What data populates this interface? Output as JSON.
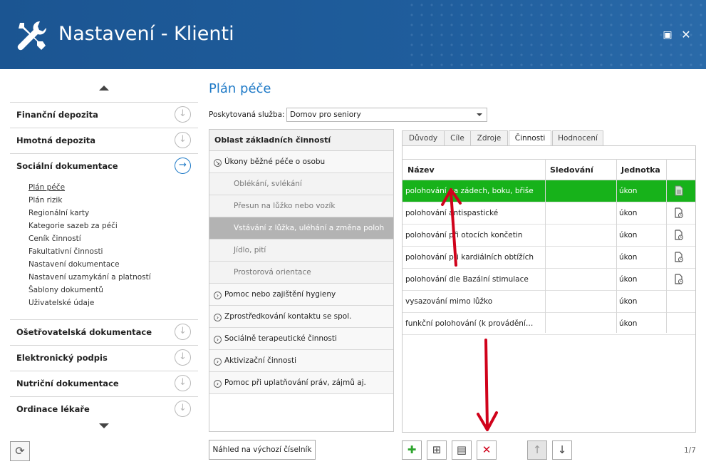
{
  "window": {
    "title": "Nastavení - Klienti",
    "maximize_glyph": "▣",
    "close_glyph": "✕"
  },
  "colors": {
    "titlebar": "#1e5b99",
    "accent": "#1f7ac7",
    "selected_row": "#17b21a",
    "selected_area": "#b3b3b3",
    "annotation_arrow": "#d0021b"
  },
  "sidebar": {
    "sections": [
      {
        "label": "Finanční depozita",
        "icon": "chevron-down-circle-icon"
      },
      {
        "label": "Hmotná depozita",
        "icon": "chevron-down-circle-icon"
      },
      {
        "label": "Sociální dokumentace",
        "icon": "arrow-right-circle-icon",
        "active": true
      },
      {
        "label": "Ošetřovatelská dokumentace",
        "icon": "chevron-down-circle-icon"
      },
      {
        "label": "Elektronický podpis",
        "icon": "chevron-down-circle-icon"
      },
      {
        "label": "Nutriční dokumentace",
        "icon": "chevron-down-circle-icon"
      },
      {
        "label": "Ordinace lékaře",
        "icon": "chevron-down-circle-icon"
      }
    ],
    "sub_items": [
      "Plán péče",
      "Plán rizik",
      "Regionální karty",
      "Kategorie sazeb za péči",
      "Ceník činností",
      "Fakultativní činnosti",
      "Nastavení dokumentace",
      "Nastavení uzamykání a platností",
      "Šablony dokumentů",
      "Uživatelské údaje"
    ]
  },
  "main": {
    "title": "Plán péče",
    "service_label": "Poskytovaná služba:",
    "service_value": "Domov pro seniory",
    "area_header": "Oblast základních činností",
    "areas": [
      {
        "label": "Úkony běžné péče o osobu",
        "kind": "group-open"
      },
      {
        "label": "Oblékání, svlékání",
        "kind": "child"
      },
      {
        "label": "Přesun na lůžko nebo vozík",
        "kind": "child"
      },
      {
        "label": "Vstávání z lůžka, uléhání a změna poloh",
        "kind": "child-selected"
      },
      {
        "label": "Jídlo, pití",
        "kind": "child"
      },
      {
        "label": "Prostorová orientace",
        "kind": "child"
      },
      {
        "label": "Pomoc nebo zajištění hygieny",
        "kind": "group"
      },
      {
        "label": "Zprostředkování kontaktu se spol.",
        "kind": "group"
      },
      {
        "label": "Sociálně terapeutické činnosti",
        "kind": "group"
      },
      {
        "label": "Aktivizační činnosti",
        "kind": "group"
      },
      {
        "label": "Pomoc při uplatňování práv, zájmů aj.",
        "kind": "group"
      }
    ],
    "tabs": [
      "Důvody",
      "Cíle",
      "Zdroje",
      "Činnosti",
      "Hodnocení"
    ],
    "active_tab": "Činnosti",
    "grid": {
      "columns": [
        "Název",
        "Sledování",
        "Jednotka"
      ],
      "rows": [
        {
          "name": "polohování na zádech, boku, břiše",
          "unit": "úkon",
          "icon": "document-icon",
          "selected": true
        },
        {
          "name": "polohování antispastické",
          "unit": "úkon",
          "icon": "document-clock-icon"
        },
        {
          "name": "polohování při otocích končetin",
          "unit": "úkon",
          "icon": "document-clock-icon"
        },
        {
          "name": "polohování při kardiálních obtížích",
          "unit": "úkon",
          "icon": "document-clock-icon"
        },
        {
          "name": "polohování dle Bazální stimulace",
          "unit": "úkon",
          "icon": "document-clock-icon"
        },
        {
          "name": "vysazování mimo lůžko",
          "unit": "úkon"
        },
        {
          "name": "funkční polohování (k provádění…",
          "unit": "úkon"
        }
      ]
    },
    "default_codebook_button": "Náhled na výchozí číselník",
    "toolbar": {
      "add": "✚",
      "add_sub": "⊞",
      "edit": "▤",
      "delete": "✕",
      "up": "↑",
      "down": "↓"
    },
    "pager": "1/7"
  }
}
